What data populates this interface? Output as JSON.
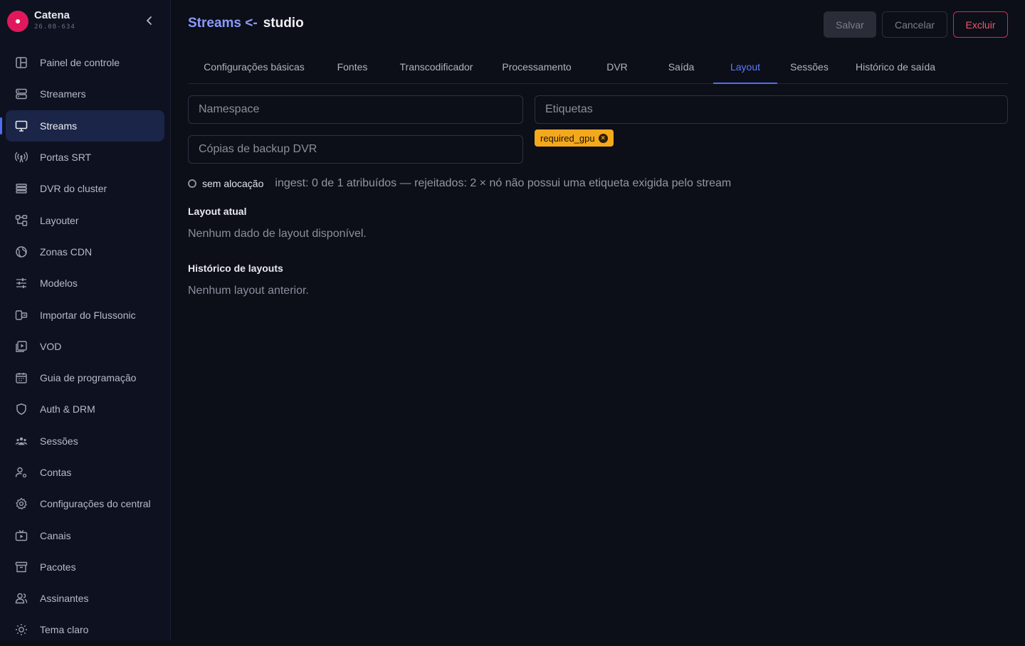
{
  "brand": {
    "name": "Catena",
    "version": "26.08-634"
  },
  "sidebar": {
    "items": [
      {
        "label": "Painel de controle",
        "icon": "dashboard-icon"
      },
      {
        "label": "Streamers",
        "icon": "server-icon"
      },
      {
        "label": "Streams",
        "icon": "monitor-icon",
        "active": true
      },
      {
        "label": "Portas SRT",
        "icon": "antenna-icon"
      },
      {
        "label": "DVR do cluster",
        "icon": "database-icon"
      },
      {
        "label": "Layouter",
        "icon": "layout-icon"
      },
      {
        "label": "Zonas CDN",
        "icon": "globe-icon"
      },
      {
        "label": "Modelos",
        "icon": "sliders-icon"
      },
      {
        "label": "Importar do Flussonic",
        "icon": "import-icon"
      },
      {
        "label": "VOD",
        "icon": "video-library-icon"
      },
      {
        "label": "Guia de programação",
        "icon": "calendar-icon"
      },
      {
        "label": "Auth & DRM",
        "icon": "shield-icon"
      },
      {
        "label": "Sessões",
        "icon": "users-group-icon"
      },
      {
        "label": "Contas",
        "icon": "user-settings-icon"
      },
      {
        "label": "Configurações do central",
        "icon": "gear-icon"
      },
      {
        "label": "Canais",
        "icon": "tv-icon"
      },
      {
        "label": "Pacotes",
        "icon": "archive-icon"
      },
      {
        "label": "Assinantes",
        "icon": "subscribers-icon"
      },
      {
        "label": "Tema claro",
        "icon": "sun-icon"
      }
    ]
  },
  "header": {
    "crumb": "Streams <-",
    "name": "studio"
  },
  "actions": {
    "save": "Salvar",
    "cancel": "Cancelar",
    "delete": "Excluir"
  },
  "tabs": [
    {
      "label": "Configurações básicas"
    },
    {
      "label": "Fontes"
    },
    {
      "label": "Transcodificador"
    },
    {
      "label": "Processamento"
    },
    {
      "label": "DVR"
    },
    {
      "label": "Saída"
    },
    {
      "label": "Layout",
      "active": true
    },
    {
      "label": "Sessões"
    },
    {
      "label": "Histórico de saída"
    }
  ],
  "form": {
    "namespace_placeholder": "Namespace",
    "labels_placeholder": "Etiquetas",
    "backup_placeholder": "Cópias de backup DVR",
    "tag": "required_gpu"
  },
  "allocation": {
    "state": "sem alocação",
    "detail": "ingest: 0 de 1 atribuídos — rejeitados: 2 × nó não possui uma etiqueta exigida pelo stream"
  },
  "current_layout": {
    "title": "Layout atual",
    "empty": "Nenhum dado de layout disponível."
  },
  "layout_history": {
    "title": "Histórico de layouts",
    "empty": "Nenhum layout anterior."
  },
  "colors": {
    "accent": "#4f6df5",
    "brand": "#e0195c",
    "tag": "#f4a81c",
    "danger": "#e0294e"
  }
}
